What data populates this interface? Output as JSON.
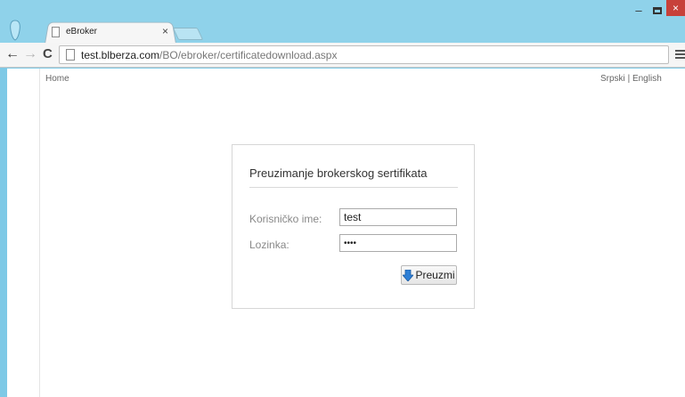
{
  "browser": {
    "tab_title": "eBroker",
    "tab_close": "×",
    "url_host": "test.blberza.com",
    "url_path": "/BO/ebroker/certificatedownload.aspx",
    "window_min": "–",
    "window_close": "×",
    "back": "←",
    "forward": "→",
    "reload": "C"
  },
  "page": {
    "home_link": "Home",
    "lang_sr": "Srpski",
    "lang_sep": " | ",
    "lang_en": "English"
  },
  "form": {
    "title": "Preuzimanje brokerskog sertifikata",
    "username_label": "Korisničko ime:",
    "username_value": "test",
    "password_label": "Lozinka:",
    "password_value": "••••",
    "submit_label": "Preuzmi"
  },
  "colors": {
    "titlebar": "#8fd2ea",
    "close_button": "#c7413a",
    "button_icon": "#2e7fd6"
  }
}
